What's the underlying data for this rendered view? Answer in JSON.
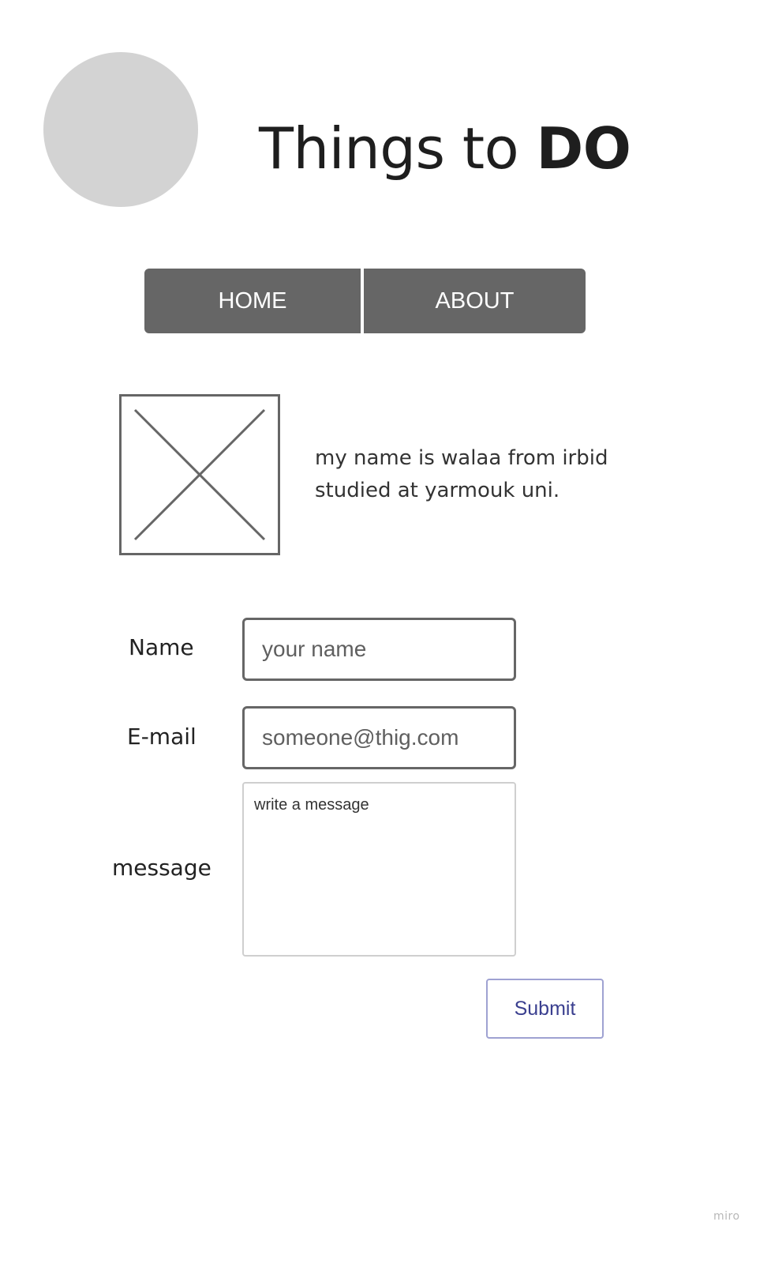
{
  "header": {
    "title_regular": "Things to ",
    "title_bold": "DO"
  },
  "nav": {
    "items": [
      {
        "label": "HOME"
      },
      {
        "label": "ABOUT"
      }
    ]
  },
  "about": {
    "bio_line1": "my name is walaa from irbid",
    "bio_line2": "studied at yarmouk uni."
  },
  "form": {
    "name_label": "Name",
    "name_placeholder": "your name",
    "email_label": "E-mail",
    "email_placeholder": "someone@thig.com",
    "message_label": "message",
    "message_placeholder": "write a message",
    "submit_label": "Submit"
  },
  "footer": {
    "watermark": "miro"
  },
  "colors": {
    "nav_bg": "#666666",
    "logo_placeholder": "#d3d3d3",
    "submit_text": "#3a3f8f",
    "submit_border": "#9fa2d2"
  }
}
